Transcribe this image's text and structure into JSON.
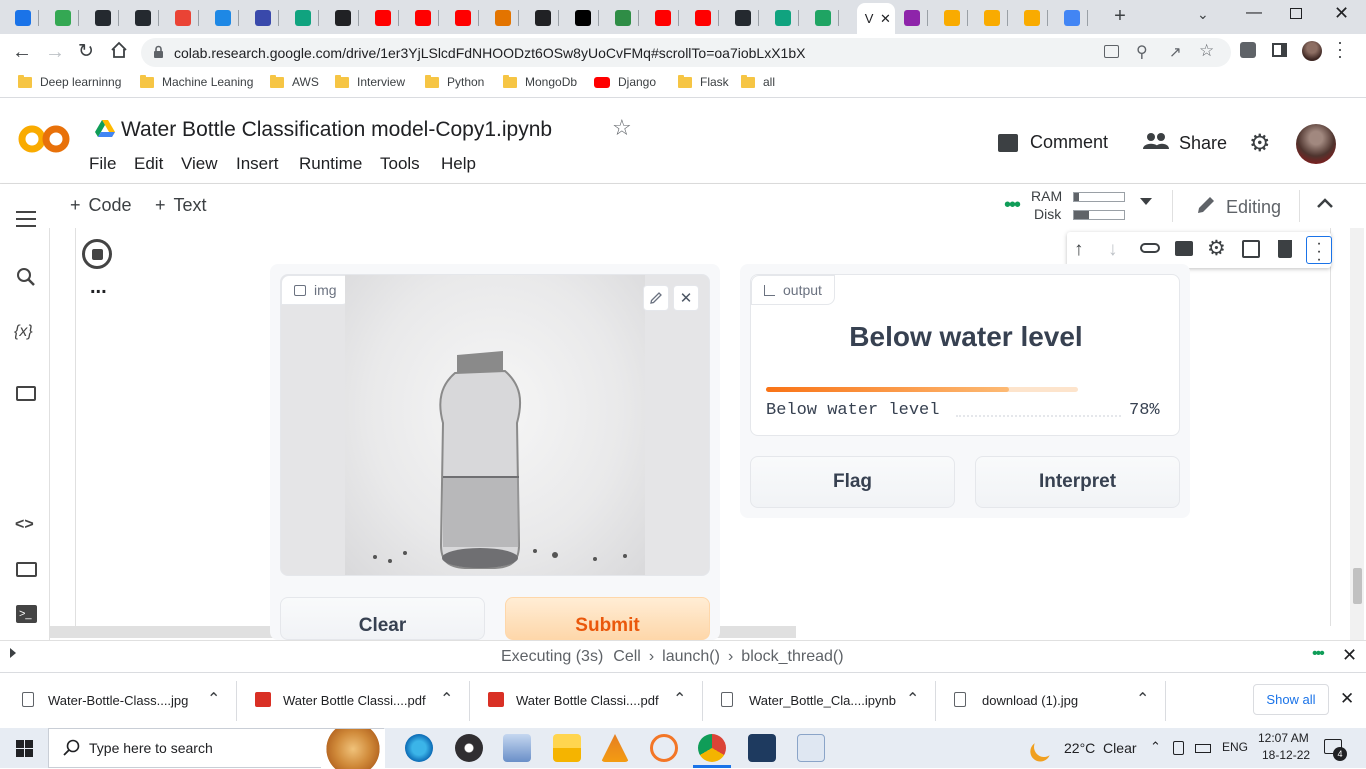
{
  "browser": {
    "tabs": [
      {
        "icon": "download-icon",
        "color": "#1a73e8"
      },
      {
        "icon": "number-one-icon",
        "color": "#34a853"
      },
      {
        "icon": "github-icon",
        "color": "#24292f"
      },
      {
        "icon": "github-icon",
        "color": "#24292f"
      },
      {
        "icon": "gmail-icon",
        "color": "#ea4335"
      },
      {
        "icon": "is-icon",
        "color": "#1e88e5"
      },
      {
        "icon": "moon-icon",
        "color": "#3949ab"
      },
      {
        "icon": "openai-icon",
        "color": "#10a37f"
      },
      {
        "icon": "openai-icon",
        "color": "#202124"
      },
      {
        "icon": "youtube-icon",
        "color": "#ff0000"
      },
      {
        "icon": "youtube-icon",
        "color": "#ff0000"
      },
      {
        "icon": "youtube-icon",
        "color": "#ff0000"
      },
      {
        "icon": "code-icon",
        "color": "#e37400"
      },
      {
        "icon": "hashnode-icon",
        "color": "#202124"
      },
      {
        "icon": "medium-icon",
        "color": "#000000"
      },
      {
        "icon": "geeks-icon",
        "color": "#2f8d46"
      },
      {
        "icon": "youtube-icon",
        "color": "#ff0000"
      },
      {
        "icon": "youtube-icon",
        "color": "#ff0000"
      },
      {
        "icon": "github-icon",
        "color": "#24292f"
      },
      {
        "icon": "openai-icon",
        "color": "#10a37f"
      },
      {
        "icon": "drive-icon",
        "color": "#1fa463"
      },
      {
        "icon": "active-tab",
        "color": "#ffffff",
        "label": "V"
      },
      {
        "icon": "browser-icon",
        "color": "#8e24aa"
      },
      {
        "icon": "colab-icon",
        "color": "#f9ab00"
      },
      {
        "icon": "slides-icon",
        "color": "#f9ab00"
      },
      {
        "icon": "slides-icon",
        "color": "#f9ab00"
      },
      {
        "icon": "google-icon",
        "color": "#4285f4"
      }
    ],
    "url": "colab.research.google.com/drive/1er3YjLSlcdFdNHOODzt6OSw8yUoCvFMq#scrollTo=oa7iobLxX1bX",
    "bookmarks": [
      "Deep learninng",
      "Machine Leaning",
      "AWS",
      "Interview",
      "Python",
      "MongoDb",
      "Django",
      "Flask",
      "all"
    ]
  },
  "colab": {
    "title": "Water Bottle Classification model-Copy1.ipynb",
    "menu": [
      "File",
      "Edit",
      "View",
      "Insert",
      "Runtime",
      "Tools",
      "Help"
    ],
    "comment_label": "Comment",
    "share_label": "Share",
    "code_label": "Code",
    "text_label": "Text",
    "ram_label": "RAM",
    "disk_label": "Disk",
    "ram_fraction": 0.1,
    "disk_fraction": 0.3,
    "editing_label": "Editing",
    "status_text": "Executing (3s)",
    "status_crumbs": [
      "Cell",
      "launch()",
      "block_thread()"
    ],
    "cell_more": "..."
  },
  "gradio": {
    "input_label": "img",
    "output_label": "output",
    "prediction": "Below water level",
    "confidences": [
      {
        "label": "Below water level",
        "value": "78%",
        "fraction": 0.78
      }
    ],
    "clear_label": "Clear",
    "submit_label": "Submit",
    "flag_label": "Flag",
    "interpret_label": "Interpret",
    "accent": "#f97316"
  },
  "downloads": {
    "items": [
      "Water-Bottle-Class....jpg",
      "Water Bottle Classi....pdf",
      "Water Bottle Classi....pdf",
      "Water_Bottle_Cla....ipynb",
      "download (1).jpg"
    ],
    "show_all": "Show all"
  },
  "taskbar": {
    "search_placeholder": "Type here to search",
    "weather": "22°C  Clear",
    "lang": "ENG",
    "time": "12:07 AM",
    "date": "18-12-22",
    "notif_count": "4"
  }
}
